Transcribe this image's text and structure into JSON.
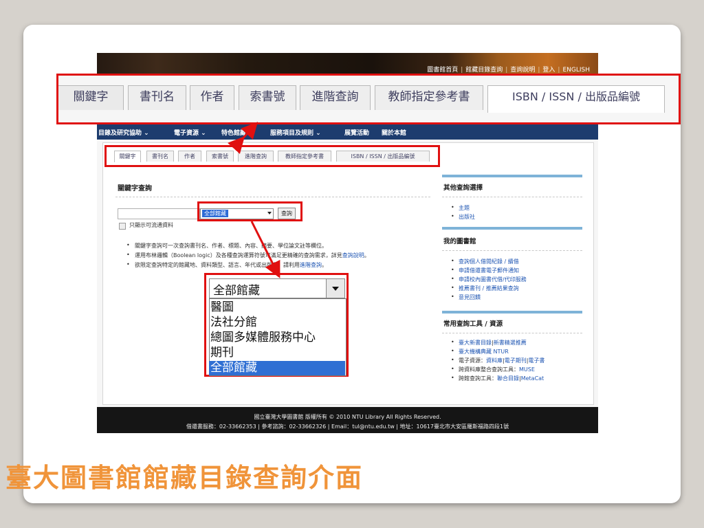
{
  "slide": {
    "title": "臺大圖書館館藏目錄查詢介面"
  },
  "header": {
    "links": [
      "圖書館首頁",
      "館藏目錄查詢",
      "查詢說明",
      "登入",
      "ENGLISH"
    ]
  },
  "tabs": [
    "關鍵字",
    "書刊名",
    "作者",
    "索書號",
    "進階查詢",
    "教師指定參考書",
    "ISBN / ISSN / 出版品編號"
  ],
  "nav": {
    "items": [
      "目錄及研究協助",
      "電子資源",
      "特色館藏",
      "服務項目及規則",
      "展覽活動",
      "關於本館"
    ]
  },
  "search": {
    "title": "關鍵字查詢",
    "keyword_value": "",
    "library_selected": "全部館藏",
    "button": "查詢",
    "checkbox_label": "只顯示可流通資料",
    "tips": [
      {
        "text": "關鍵字查詢可一次查詢書刊名、作者、標題、內容、摘要、學位論文註等欄位。",
        "link": ""
      },
      {
        "text": "運用布林邏輯（Boolean logic）及各種查詢運算符號可滿足更精確的查詢需求，詳見",
        "link": "查詢說明",
        "tail": "。"
      },
      {
        "text": "欲限定查詢特定的館藏地、資料類型、語言、年代或出版者，請利用",
        "link": "進階查詢",
        "tail": "。"
      }
    ]
  },
  "dropdown": {
    "selected": "全部館藏",
    "options": [
      "醫圖",
      "法社分館",
      "總圖多媒體服務中心",
      "期刊",
      "全部館藏"
    ],
    "highlighted_index": 4
  },
  "sidebar": {
    "other": {
      "title": "其他查詢選擇",
      "items": [
        "主題",
        "出版社"
      ]
    },
    "mylib": {
      "title": "我的圖書館",
      "items": [
        "查詢個人借閱紀錄 / 續借",
        "申請借還書電子郵件通知",
        "申請校內圖書代借/代印服務",
        "推薦書刊 / 推薦結果查詢",
        "意見回饋"
      ]
    },
    "tools": {
      "title": "常用查詢工具 / 資源",
      "items": [
        {
          "parts": [
            "臺大新書目錄",
            "新書精選推薦"
          ]
        },
        {
          "parts": [
            "臺大機構典藏 NTUR"
          ]
        },
        {
          "label": "電子資源：",
          "parts": [
            "資料庫",
            "電子期刊",
            "電子書"
          ]
        },
        {
          "label": "跨資料庫整合查詢工具：",
          "parts": [
            "MUSE"
          ]
        },
        {
          "label": "跨館查詢工具：",
          "parts": [
            "聯合目錄",
            "MetaCat"
          ]
        }
      ]
    }
  },
  "footer": {
    "line1": "國立臺灣大學圖書館 版權所有 © 2010 NTU Library All Rights Reserved.",
    "line2": "借還書服務：02-33662353 | 參考諮詢：02-33662326 | Email：tul@ntu.edu.tw | 地址：10617臺北市大安區羅斯福路四段1號"
  },
  "colors": {
    "callout": "#e01010",
    "navbar": "#1d3c6e",
    "title": "#f0943a",
    "link": "#1f56b3",
    "highlight": "#2f6fd3"
  }
}
